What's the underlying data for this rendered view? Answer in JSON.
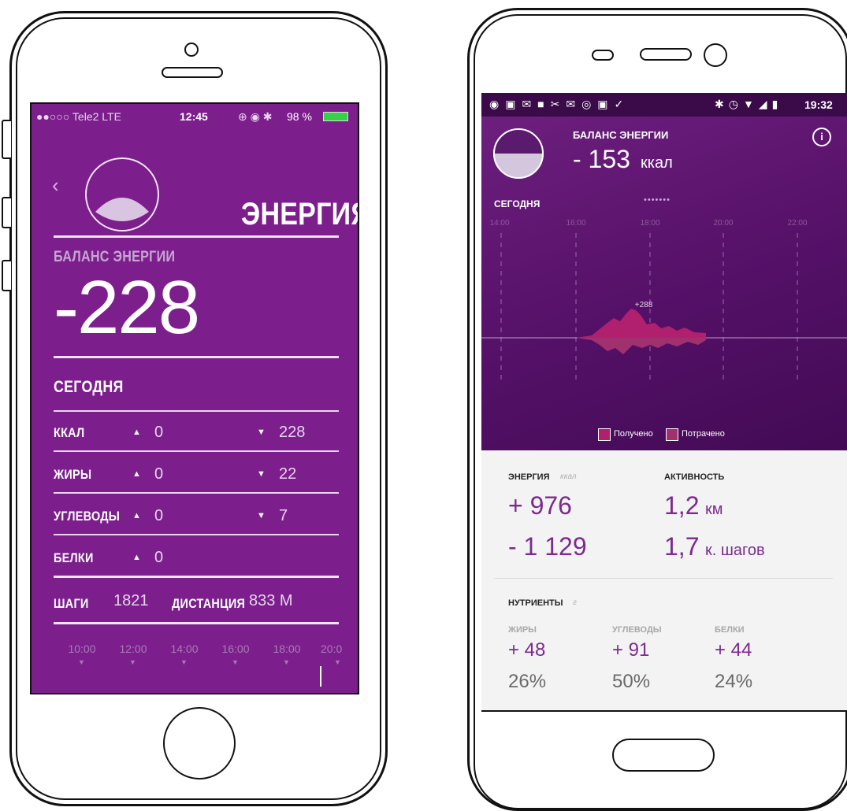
{
  "iphone": {
    "status": {
      "carrier": "●●○○○ Tele2  LTE",
      "time": "12:45",
      "battery": "98 %"
    },
    "header": {
      "back_icon": "chevron-left-icon",
      "title": "ЭНЕРГИЯ"
    },
    "balance": {
      "label": "БАЛАНС ЭНЕРГИИ",
      "value": "-228"
    },
    "today_label": "СЕГОДНЯ",
    "rows": [
      {
        "label": "ККАЛ",
        "up": "0",
        "down": "228"
      },
      {
        "label": "ЖИРЫ",
        "up": "0",
        "down": "22"
      },
      {
        "label": "УГЛЕВОДЫ",
        "up": "0",
        "down": "7"
      },
      {
        "label": "БЕЛКИ",
        "up": "0",
        "down": ""
      }
    ],
    "steps": {
      "label": "ШАГИ",
      "value": "1821",
      "distance_label": "ДИСТАНЦИЯ",
      "distance_value": "833 М"
    },
    "timeline": [
      "10:00",
      "12:00",
      "14:00",
      "16:00",
      "18:00",
      "20:0"
    ],
    "up_glyph": "▲",
    "down_glyph": "▼"
  },
  "android": {
    "status": {
      "time": "19:32"
    },
    "header": {
      "title": "БАЛАНС ЭНЕРГИИ",
      "value": "- 153",
      "unit": "ккал",
      "info_icon": "info-icon"
    },
    "today_label": "СЕГОДНЯ",
    "page_dots": "•••••••",
    "chart_hours": [
      "14:00",
      "16:00",
      "18:00",
      "20:00",
      "22:00"
    ],
    "chart_peak_label": "+288",
    "legend": {
      "received": "Получено",
      "spent": "Потрачено"
    },
    "colors": {
      "received": "#b0206f",
      "spent": "#a0306e"
    },
    "energy": {
      "label": "ЭНЕРГИЯ",
      "unit": "ккал",
      "plus": "+ 976",
      "minus": "- 1 129"
    },
    "activity": {
      "label": "АКТИВНОСТЬ",
      "km_value": "1,2",
      "km_unit": "км",
      "steps_value": "1,7",
      "steps_unit": "к. шагов"
    },
    "nutrients": {
      "label": "НУТРИЕНТЫ",
      "unit": "г",
      "items": [
        {
          "name": "ЖИРЫ",
          "value": "+ 48",
          "pct": "26%"
        },
        {
          "name": "УГЛЕВОДЫ",
          "value": "+ 91",
          "pct": "50%"
        },
        {
          "name": "БЕЛКИ",
          "value": "+ 44",
          "pct": "24%"
        }
      ]
    }
  }
}
